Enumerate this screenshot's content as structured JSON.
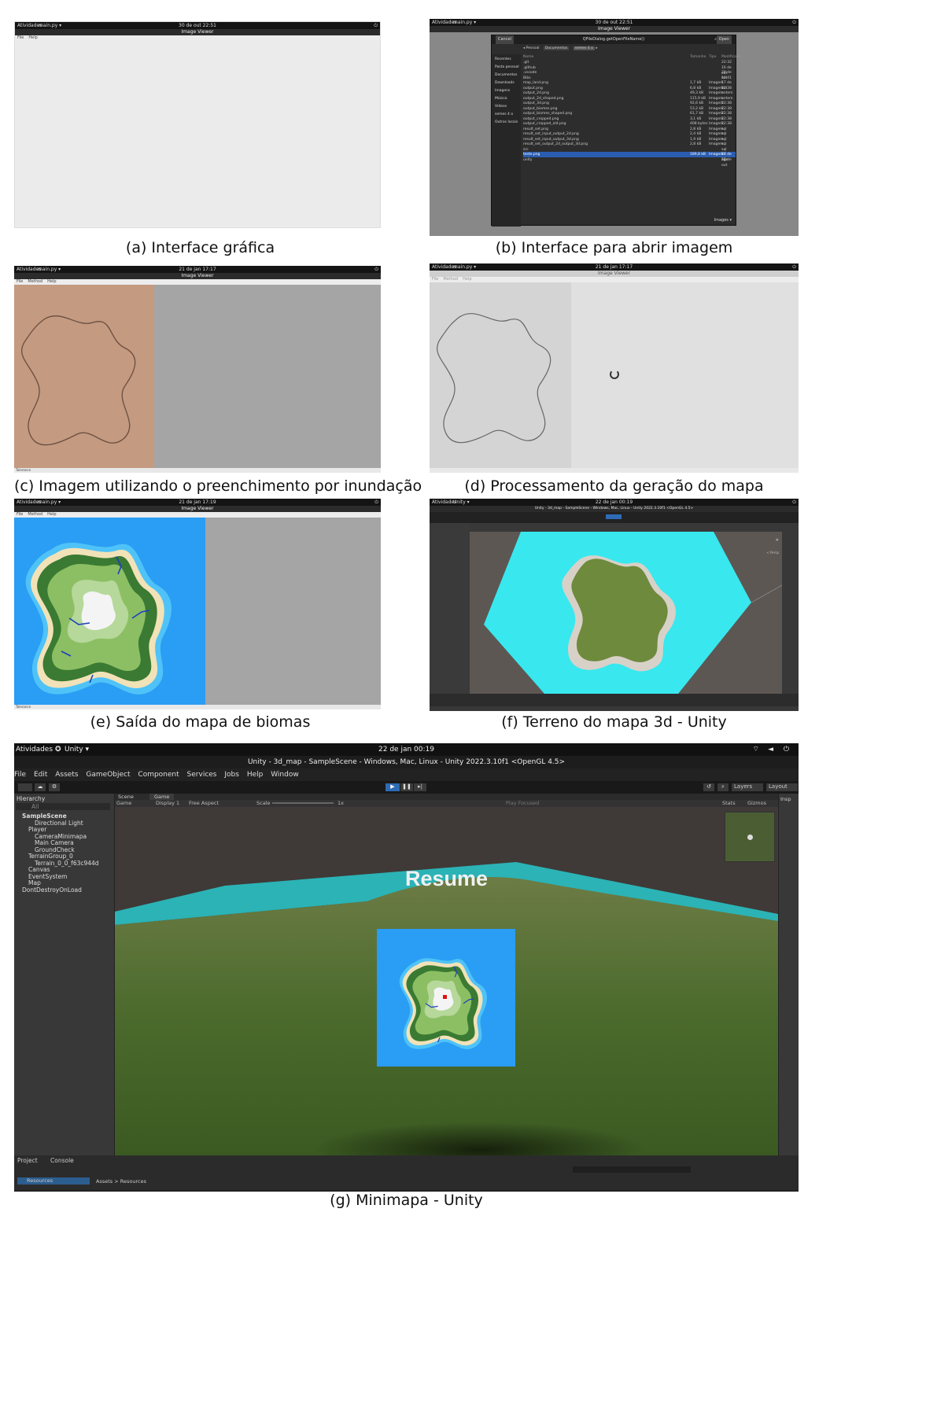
{
  "panel_a": {
    "caption": "(a) Interface gráfica",
    "gnome": {
      "activities": "Atividades",
      "app": "main.py ▾",
      "clock": "30 de out  22:51"
    },
    "title": "Image Viewer",
    "menu": [
      "File",
      "Help"
    ]
  },
  "panel_b": {
    "caption": "(b) Interface para abrir imagem",
    "gnome": {
      "activities": "Atividades",
      "app": "main.py ▾",
      "clock": "30 de out  22:51"
    },
    "title": "Image Viewer",
    "dialog": {
      "cancel": "Cancel",
      "title": "QFileDialog.getOpenFileName()",
      "open": "Open",
      "path": [
        "Pessoal",
        "Documentos",
        "semes 4 o"
      ],
      "sidebar": [
        "Recentes",
        "Pasta pessoal",
        "Documentos",
        "Downloads",
        "Imagens",
        "Música",
        "Vídeos",
        "semes 4 o",
        "Outros locais"
      ],
      "headers": [
        "Nome",
        "Tamanho",
        "Tipo",
        "Modificado"
      ],
      "files": [
        {
          "name": ".git",
          "size": "",
          "type": "",
          "mod": "22:32"
        },
        {
          "name": ".github",
          "size": "",
          "type": "",
          "mod": "16 de out"
        },
        {
          "name": ".vscode",
          "size": "",
          "type": "",
          "mod": "28 de out"
        },
        {
          "name": "Bibs",
          "size": "",
          "type": "",
          "mod": "10:41"
        },
        {
          "name": "map_land.png",
          "size": "1,7 kB",
          "type": "Imagem",
          "mod": "17 de out"
        },
        {
          "name": "output.png",
          "size": "6,8 kB",
          "type": "Imagem",
          "mod": "22:38"
        },
        {
          "name": "output_2d.png",
          "size": "49,3 kB",
          "type": "Imagem",
          "mod": "ontem"
        },
        {
          "name": "output_2d_shaped.png",
          "size": "115,9 kB",
          "type": "Imagem",
          "mod": "ontem"
        },
        {
          "name": "output_3d.png",
          "size": "92,6 kB",
          "type": "Imagem",
          "mod": "22:38"
        },
        {
          "name": "output_biomes.png",
          "size": "53,2 kB",
          "type": "Imagem",
          "mod": "22:38"
        },
        {
          "name": "output_biomes_shaped.png",
          "size": "61,7 kB",
          "type": "Imagem",
          "mod": "22:38"
        },
        {
          "name": "output_cropped.png",
          "size": "3,1 kB",
          "type": "Imagem",
          "mod": "22:38"
        },
        {
          "name": "output_cropped_old.png",
          "size": "408 bytes",
          "type": "Imagem",
          "mod": "22:38"
        },
        {
          "name": "result_set.png",
          "size": "2,8 kB",
          "type": "Imagem",
          "mod": "sql"
        },
        {
          "name": "result_set_input_output_2d.png",
          "size": "2,4 kB",
          "type": "Imagem",
          "mod": "sql"
        },
        {
          "name": "result_set_input_output_3d.png",
          "size": "1,9 kB",
          "type": "Imagem",
          "mod": "sql"
        },
        {
          "name": "result_set_output_2d_output_3d.png",
          "size": "2,8 kB",
          "type": "Imagem",
          "mod": "sql"
        },
        {
          "name": "src",
          "size": "",
          "type": "",
          "mod": "sql"
        },
        {
          "name": "teste.png",
          "size": "189,8 kB",
          "type": "Imagem",
          "mod": "28 de ago"
        },
        {
          "name": "unity",
          "size": "",
          "type": "",
          "mod": "27 de out"
        }
      ],
      "filter": "Images ▾"
    }
  },
  "panel_c": {
    "caption": "(c) Imagem utilizando o preenchimento por inundação",
    "gnome": {
      "activities": "Atividades",
      "app": "main.py ▾",
      "clock": "21 de jan  17:17"
    },
    "title": "Image Viewer",
    "menu": [
      "File",
      "Method",
      "Help"
    ],
    "status": "Tolerance"
  },
  "panel_d": {
    "caption": "(d) Processamento da geração do mapa",
    "gnome": {
      "activities": "Atividades",
      "app": "main.py ▾",
      "clock": "21 de jan  17:17"
    },
    "title": "Image Viewer",
    "menu": [
      "File",
      "Method",
      "Help"
    ]
  },
  "panel_e": {
    "caption": "(e) Saída do mapa de biomas",
    "gnome": {
      "activities": "Atividades",
      "app": "main.py ▾",
      "clock": "21 de jan  17:19"
    },
    "title": "Image Viewer",
    "menu": [
      "File",
      "Method",
      "Help"
    ],
    "status": "Tolerance"
  },
  "panel_f": {
    "caption": "(f) Terreno do mapa 3d - Unity",
    "gnome": {
      "activities": "Atividades",
      "app": "Unity ▾",
      "clock": "22 de jan  00:19"
    },
    "title": "Unity - 3d_map - SampleScene - Windows, Mac, Linux - Unity 2022.3.10f1 <OpenGL 4.5>",
    "persp": "< Persp"
  },
  "panel_g": {
    "caption": "(g) Minimapa - Unity",
    "gnome": {
      "activities": "Atividades",
      "app": "Unity ▾",
      "clock": "22 de jan  00:19"
    },
    "title": "Unity - 3d_map - SampleScene - Windows, Mac, Linux - Unity 2022.3.10f1 <OpenGL 4.5>",
    "menu": [
      "File",
      "Edit",
      "Assets",
      "GameObject",
      "Component",
      "Services",
      "Jobs",
      "Help",
      "Window"
    ],
    "toolbar": {
      "layers": "Layers",
      "layout": "Layout"
    },
    "hierarchy": {
      "tab": "Hierarchy",
      "search": "All",
      "items": [
        {
          "label": "SampleScene",
          "depth": 0,
          "bold": true
        },
        {
          "label": "Directional Light",
          "depth": 2
        },
        {
          "label": "Player",
          "depth": 1
        },
        {
          "label": "CameraMinimapa",
          "depth": 2
        },
        {
          "label": "Main Camera",
          "depth": 2
        },
        {
          "label": "GroundCheck",
          "depth": 2
        },
        {
          "label": "TerrainGroup_0",
          "depth": 1
        },
        {
          "label": "Terrain_0_0_f63c944d",
          "depth": 2
        },
        {
          "label": "Canvas",
          "depth": 1
        },
        {
          "label": "EventSystem",
          "depth": 1
        },
        {
          "label": "Map",
          "depth": 1
        },
        {
          "label": "DontDestroyOnLoad",
          "depth": 0
        }
      ]
    },
    "tabs": {
      "scene": "Scene",
      "game": "Game"
    },
    "game_bar": {
      "game": "Game",
      "display": "Display 1",
      "aspect": "Free Aspect",
      "scale": "Scale",
      "scale_val": "1x",
      "play_focused": "Play Focused",
      "stats": "Stats",
      "gizmos": "Gizmos"
    },
    "inspector": "Insp",
    "resume": "Resume",
    "bottom": {
      "project": "Project",
      "console": "Console",
      "folder": "Resources",
      "crumb1": "Assets",
      "crumb_sep": ">",
      "crumb2": "Resources"
    }
  }
}
